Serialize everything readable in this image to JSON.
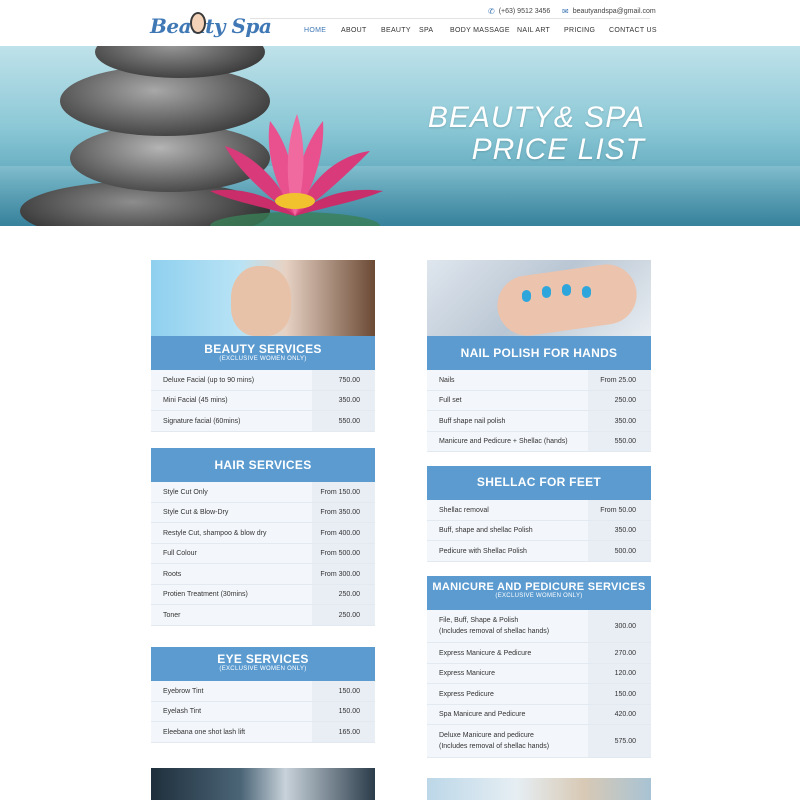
{
  "header": {
    "logo_text": "Beauty Spa",
    "phone": "(+63) 9512 3456",
    "email": "beautyandspa@gmail.com",
    "nav": [
      {
        "label": "HOME",
        "active": true
      },
      {
        "label": "ABOUT"
      },
      {
        "label": "BEAUTY"
      },
      {
        "label": "SPA"
      },
      {
        "label": "BODY MASSAGE"
      },
      {
        "label": "NAIL ART"
      },
      {
        "label": "PRICING"
      },
      {
        "label": "CONTACT US"
      }
    ]
  },
  "hero": {
    "line1": "BEAUTY& SPA",
    "line2": "PRICE LIST"
  },
  "colors": {
    "accent": "#5b9bd0",
    "brand": "#3f78b5"
  },
  "sections": {
    "beauty": {
      "title": "BEAUTY SERVICES",
      "subtitle": "(EXCLUSIVE  WOMEN ONLY)",
      "rows": [
        {
          "name": "Deluxe Facial (up to 90 mins)",
          "price": "750.00"
        },
        {
          "name": "Mini Facial (45 mins)",
          "price": "350.00"
        },
        {
          "name": "Signature facial (60mins)",
          "price": "550.00"
        }
      ]
    },
    "hair": {
      "title": "HAIR SERVICES",
      "rows": [
        {
          "name": "Style Cut Only",
          "price": "From 150.00"
        },
        {
          "name": "Style Cut & Blow-Dry",
          "price": "From 350.00"
        },
        {
          "name": "Restyle Cut, shampoo & blow dry",
          "price": "From 400.00"
        },
        {
          "name": "Full Colour",
          "price": "From 500.00"
        },
        {
          "name": "Roots",
          "price": "From 300.00"
        },
        {
          "name": "Protien Treatment (30mins)",
          "price": "250.00"
        },
        {
          "name": "Toner",
          "price": "250.00"
        }
      ]
    },
    "eye": {
      "title": "EYE SERVICES",
      "subtitle": "(EXCLUSIVE  WOMEN ONLY)",
      "rows": [
        {
          "name": "Eyebrow Tint",
          "price": "150.00"
        },
        {
          "name": "Eyelash Tint",
          "price": "150.00"
        },
        {
          "name": "Eleebana one shot lash lift",
          "price": "165.00"
        }
      ]
    },
    "nail": {
      "title": "NAIL POLISH FOR HANDS",
      "rows": [
        {
          "name": "Nails",
          "price": "From 25.00"
        },
        {
          "name": "Full set",
          "price": "250.00"
        },
        {
          "name": "Buff shape  nail polish",
          "price": "350.00"
        },
        {
          "name": "Manicure and Pedicure + Shellac (hands)",
          "price": "550.00"
        }
      ]
    },
    "shellac": {
      "title": "SHELLAC FOR FEET",
      "rows": [
        {
          "name": "Shellac removal",
          "price": "From 50.00"
        },
        {
          "name": "Buff, shape and shellac Polish",
          "price": "350.00"
        },
        {
          "name": "Pedicure with Shellac Polish",
          "price": "500.00"
        }
      ]
    },
    "manicure": {
      "title": "MANICURE AND PEDICURE SERVICES",
      "subtitle": "(EXCLUSIVE  WOMEN ONLY)",
      "rows": [
        {
          "name": "File, Buff, Shape & Polish",
          "note": "(Includes removal of shellac hands)",
          "price": "300.00"
        },
        {
          "name": "Express Manicure & Pedicure",
          "price": "270.00"
        },
        {
          "name": "Express Manicure",
          "price": "120.00"
        },
        {
          "name": "Express Pedicure",
          "price": "150.00"
        },
        {
          "name": "Spa Manicure and Pedicure",
          "price": "420.00"
        },
        {
          "name": "Deluxe Manicure and pedicure",
          "note": "(Includes removal of shellac hands)",
          "price": "575.00"
        }
      ]
    }
  }
}
